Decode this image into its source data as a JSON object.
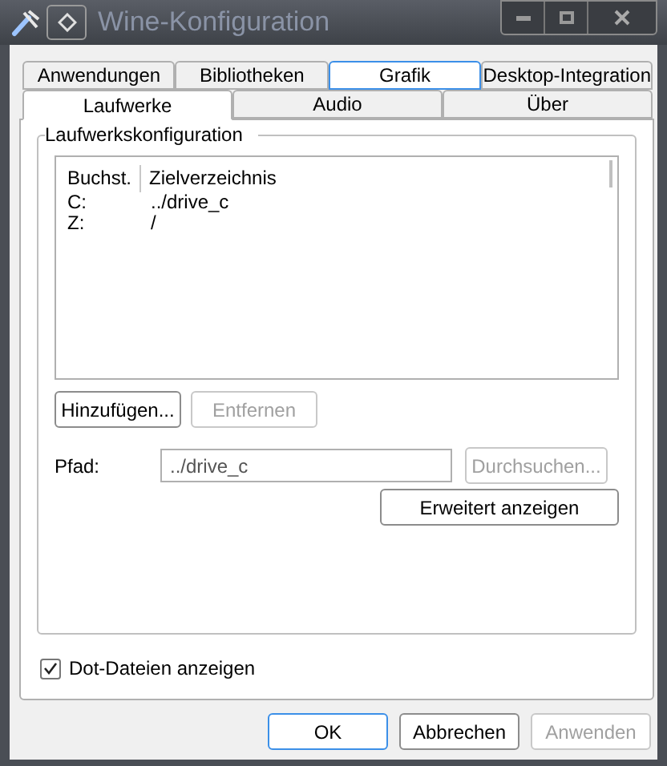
{
  "window": {
    "title": "Wine-Konfiguration"
  },
  "tab_rows": [
    [
      {
        "label": "Anwendungen",
        "selected": false,
        "focused": false
      },
      {
        "label": "Bibliotheken",
        "selected": false,
        "focused": false
      },
      {
        "label": "Grafik",
        "selected": false,
        "focused": true
      },
      {
        "label": "Desktop-Integration",
        "selected": false,
        "focused": false
      }
    ],
    [
      {
        "label": "Laufwerke",
        "selected": true,
        "focused": false
      },
      {
        "label": "Audio",
        "selected": false,
        "focused": false
      },
      {
        "label": "Über",
        "selected": false,
        "focused": false
      }
    ]
  ],
  "group": {
    "title": "Laufwerkskonfiguration",
    "table": {
      "columns": [
        "Buchst.",
        "Zielverzeichnis"
      ],
      "rows": [
        [
          "C:",
          "../drive_c"
        ],
        [
          "Z:",
          "/"
        ]
      ]
    },
    "buttons": [
      {
        "label": "Hinzufügen...",
        "disabled": false
      },
      {
        "label": "Entfernen",
        "disabled": true
      }
    ],
    "path": {
      "label": "Pfad:",
      "value": "../drive_c"
    },
    "browse_button": {
      "label": "Durchsuchen...",
      "disabled": true
    },
    "advanced_button": {
      "label": "Erweitert anzeigen",
      "disabled": false
    }
  },
  "show_dotfiles": {
    "label": "Dot-Dateien anzeigen",
    "checked": true
  },
  "footer_buttons": [
    {
      "label": "OK",
      "disabled": false,
      "default": true
    },
    {
      "label": "Abbrechen",
      "disabled": false,
      "default": false
    },
    {
      "label": "Anwenden",
      "disabled": true,
      "default": false
    }
  ]
}
